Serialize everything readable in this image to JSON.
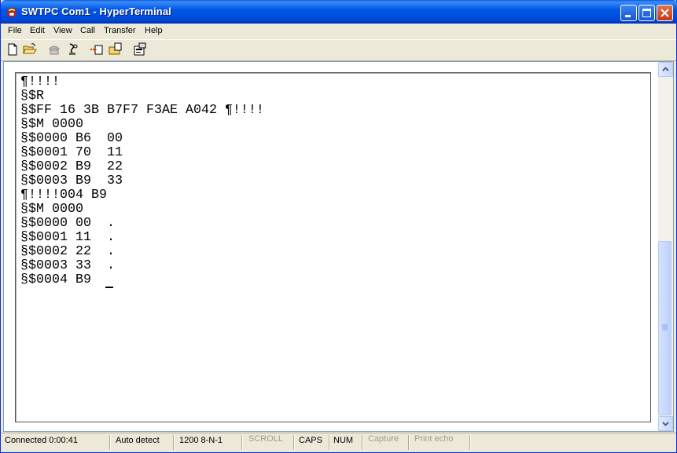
{
  "window": {
    "title": "SWTPC Com1 - HyperTerminal",
    "icon": "hyperterminal-phone-icon"
  },
  "menu": [
    "File",
    "Edit",
    "View",
    "Call",
    "Transfer",
    "Help"
  ],
  "toolbar": [
    "new-connection-icon",
    "open-icon",
    "connect-phone-icon",
    "disconnect-phone-icon",
    "send-icon",
    "receive-icon",
    "properties-icon"
  ],
  "terminal": {
    "lines": [
      "¶!!!!",
      "§$R",
      "§$FF 16 3B B7F7 F3AE A042 ¶!!!!",
      "§$M 0000",
      "§$0000 B6  00",
      "§$0001 70  11",
      "§$0002 B9  22",
      "§$0003 B9  33",
      "¶!!!!004 B9",
      "§$M 0000",
      "§$0000 00  .",
      "§$0001 11  .",
      "§$0002 22  .",
      "§$0003 33  .",
      "§$0004 B9  "
    ]
  },
  "status": {
    "connected": "Connected 0:00:41",
    "detect": "Auto detect",
    "settings": "1200 8-N-1",
    "scroll": "SCROLL",
    "caps": "CAPS",
    "num": "NUM",
    "capture": "Capture",
    "print_echo": "Print echo"
  }
}
